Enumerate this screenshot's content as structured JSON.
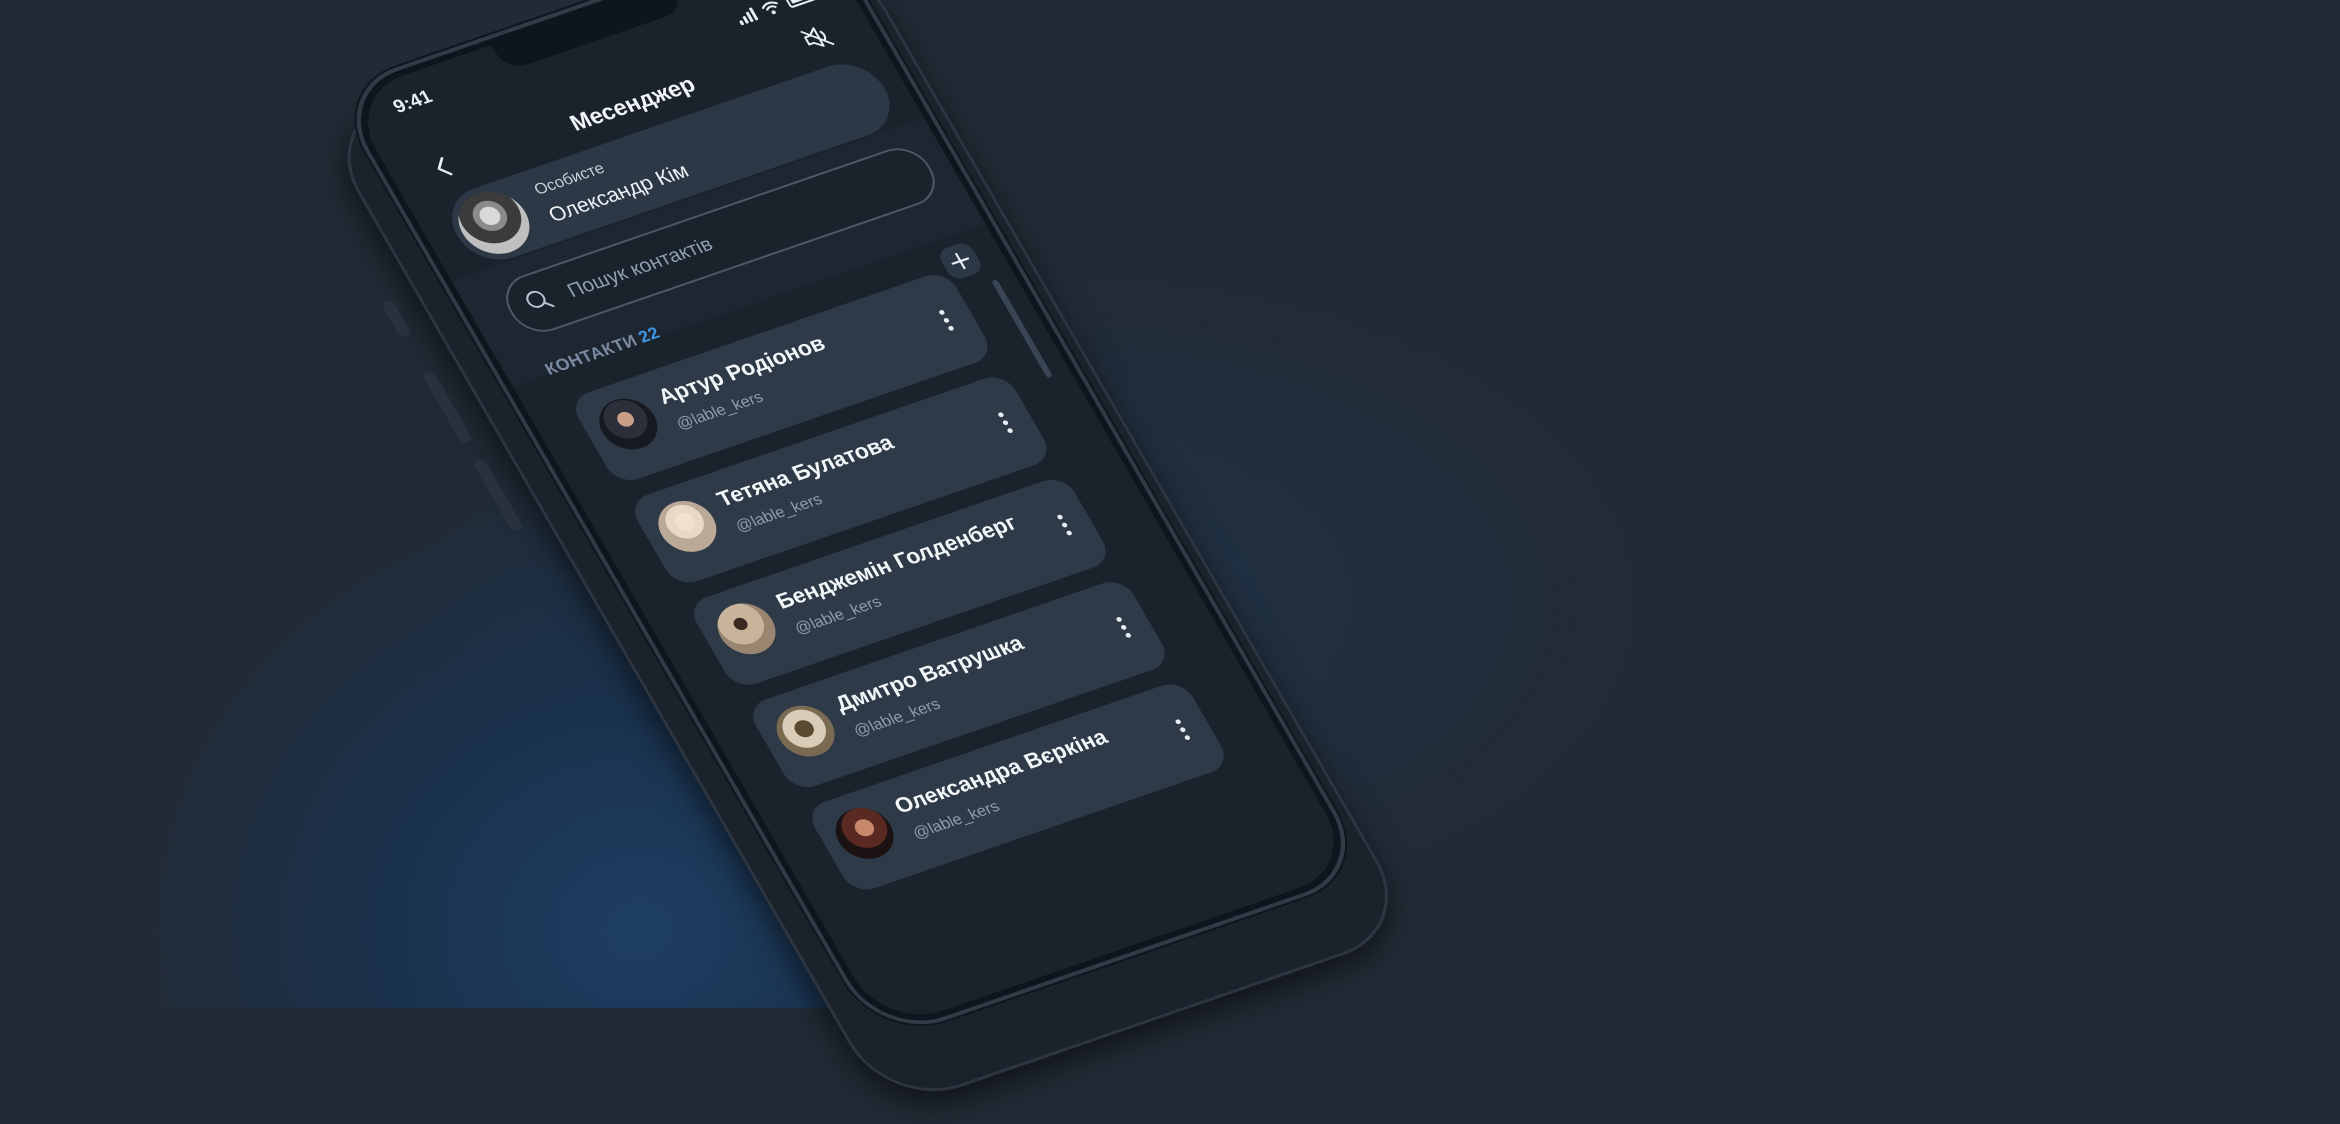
{
  "status_bar": {
    "time": "9:41"
  },
  "header": {
    "title": "Месенджер"
  },
  "profile": {
    "label": "Особисте",
    "name": "Олександр Кім"
  },
  "search": {
    "placeholder": "Пошук контактів"
  },
  "contacts_section": {
    "label": "КОНТАКТИ",
    "count": "22"
  },
  "contacts": [
    {
      "name": "Артур Родіонов",
      "handle": "@lable_kers"
    },
    {
      "name": "Тетяна Булатова",
      "handle": "@lable_kers"
    },
    {
      "name": "Бенджемін Голденберг",
      "handle": "@lable_kers"
    },
    {
      "name": "Дмитро Ватрушка",
      "handle": "@lable_kers"
    },
    {
      "name": "Олександра Вєркіна",
      "handle": "@lable_kers"
    }
  ],
  "icons": {
    "back": "chevron-left-icon",
    "sound": "speaker-muted-icon",
    "search": "search-icon",
    "add": "plus-icon",
    "more": "more-vertical-icon"
  },
  "colors": {
    "accent": "#3f97e6",
    "card": "#2e3a48",
    "background": "#222a35"
  }
}
